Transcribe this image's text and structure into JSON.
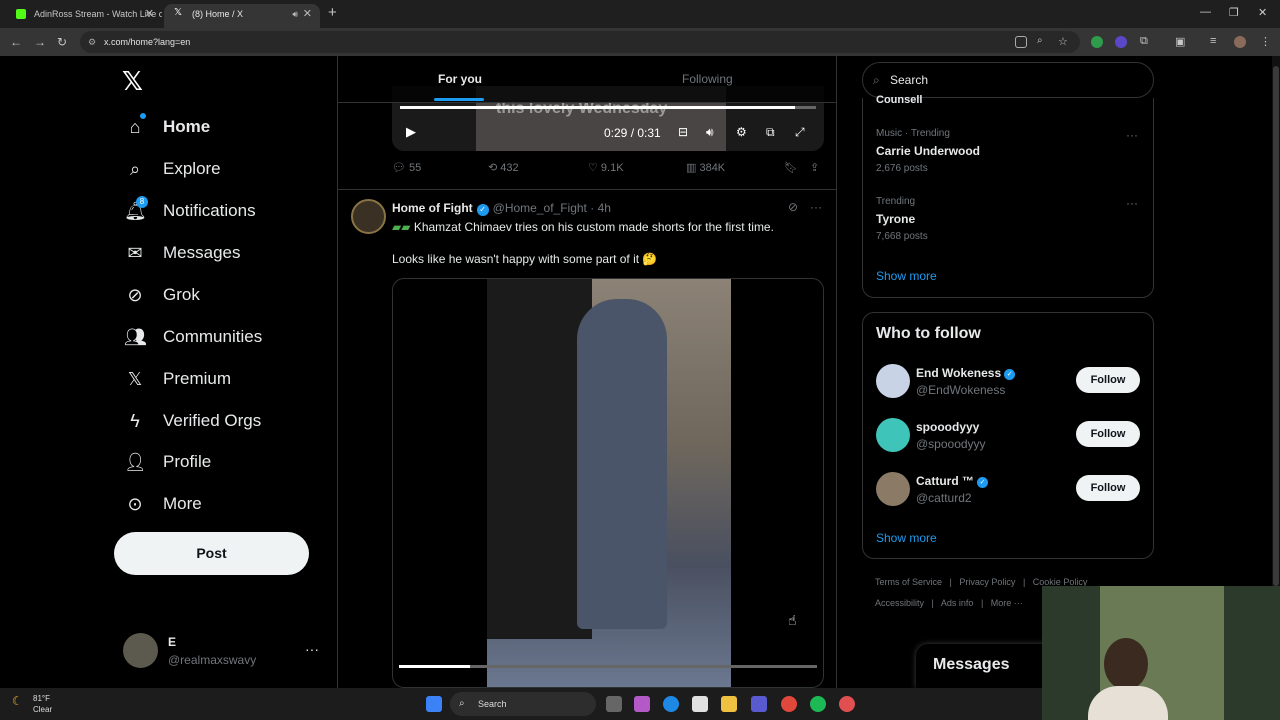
{
  "browser": {
    "tabs": [
      {
        "title": "AdinRoss Stream - Watch Live o",
        "favicon_color": "#53fc18"
      },
      {
        "title": "(8) Home / X",
        "favicon_color": "#ffffff"
      }
    ],
    "url": "x.com/home?lang=en"
  },
  "nav": {
    "items": [
      {
        "label": "Home",
        "icon": "home-icon"
      },
      {
        "label": "Explore",
        "icon": "search-icon"
      },
      {
        "label": "Notifications",
        "icon": "bell-icon",
        "badge": "8"
      },
      {
        "label": "Messages",
        "icon": "envelope-icon"
      },
      {
        "label": "Grok",
        "icon": "grok-icon"
      },
      {
        "label": "Communities",
        "icon": "people-icon"
      },
      {
        "label": "Premium",
        "icon": "x-icon"
      },
      {
        "label": "Verified Orgs",
        "icon": "lightning-icon"
      },
      {
        "label": "Profile",
        "icon": "person-icon"
      },
      {
        "label": "More",
        "icon": "more-circle-icon"
      }
    ],
    "post_label": "Post",
    "account": {
      "name": "E",
      "handle": "@realmaxswavy"
    }
  },
  "feed": {
    "tabs": {
      "for_you": "For you",
      "following": "Following"
    },
    "video1": {
      "caption": "this lovely Wednesday",
      "time": "0:29 / 0:31",
      "progress": 0.95
    },
    "actions1": {
      "replies": "55",
      "reposts": "432",
      "likes": "9.1K",
      "views": "384K"
    },
    "tweet": {
      "name": "Home of Fight",
      "handle": "@Home_of_Fight",
      "time": "4h",
      "text1": "Khamzat Chimaev tries on his custom made shorts for the first time.",
      "text2": "Looks like he wasn't happy with some part of it 🤔",
      "video_progress": 0.17
    }
  },
  "sidebar": {
    "search_placeholder": "Search",
    "partial_trend": "Counsell",
    "trends": [
      {
        "category": "Music · Trending",
        "name": "Carrie Underwood",
        "count": "2,676 posts"
      },
      {
        "category": "Trending",
        "name": "Tyrone",
        "count": "7,668 posts"
      }
    ],
    "show_more": "Show more",
    "who_to_follow_title": "Who to follow",
    "who_to_follow": [
      {
        "name": "End Wokeness",
        "handle": "@EndWokeness",
        "verified": true,
        "avatar_color": "#c9d3e6"
      },
      {
        "name": "spooodyyy",
        "handle": "@spooodyyy",
        "verified": false,
        "avatar_color": "#3fc4b9"
      },
      {
        "name": "Catturd ™",
        "handle": "@catturd2",
        "verified": true,
        "avatar_color": "#8a7a66"
      }
    ],
    "follow_label": "Follow",
    "footer": {
      "row1": [
        "Terms of Service",
        "Privacy Policy",
        "Cookie Policy"
      ],
      "row2": [
        "Accessibility",
        "Ads info",
        "More ···"
      ]
    },
    "messages_label": "Messages"
  },
  "taskbar": {
    "temp": "81°F",
    "condition": "Clear",
    "search_label": "Search"
  }
}
